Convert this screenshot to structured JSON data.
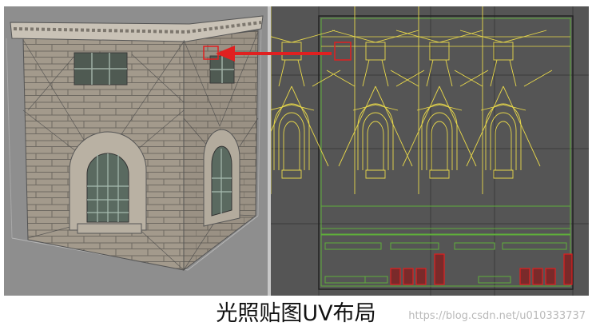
{
  "caption": "光照贴图UV布局",
  "watermark": "https://blog.csdn.net/u010333737",
  "colors": {
    "left_bg": "#8e8e8e",
    "right_bg": "#555555",
    "uv_yellow": "#e8d84a",
    "uv_green": "#5fae3a",
    "highlight_red": "#e02020"
  }
}
